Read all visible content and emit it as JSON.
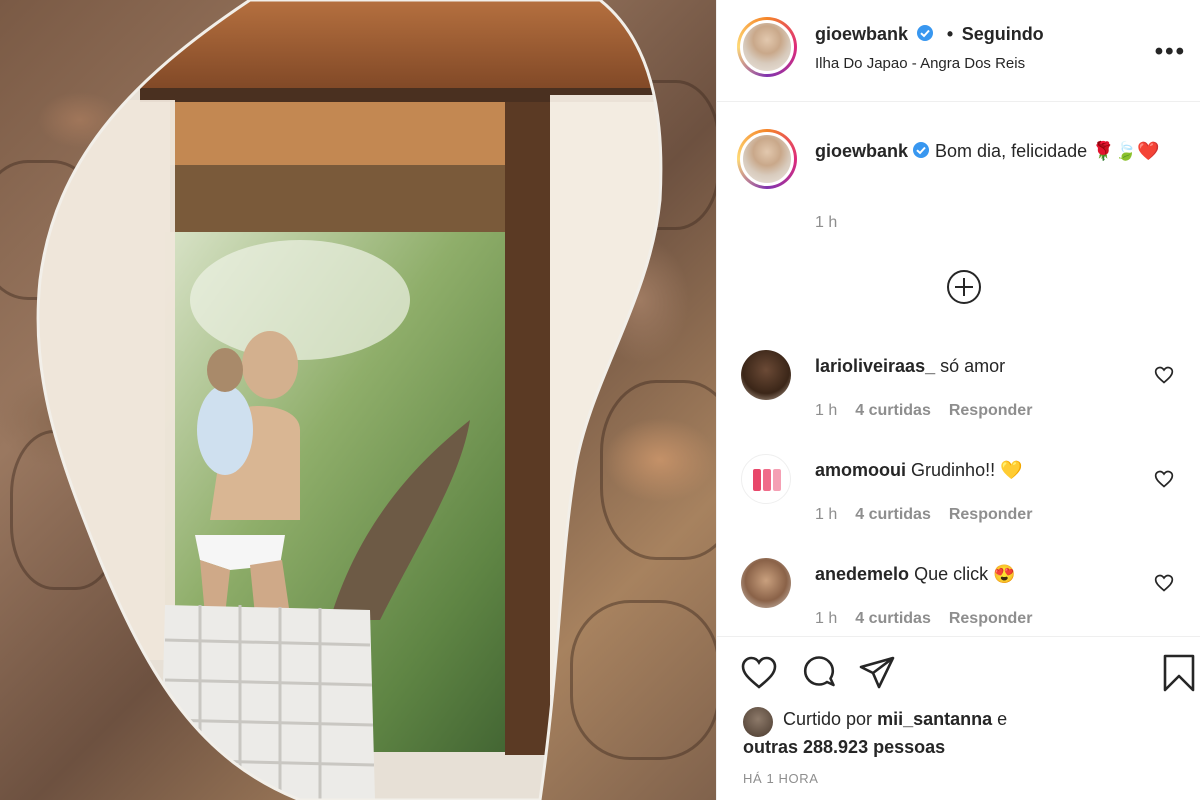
{
  "post": {
    "username": "gioewbank",
    "follow_status": "Seguindo",
    "follow_separator": "•",
    "location": "Ilha Do Japao - Angra Dos Reis",
    "more_label": "•••"
  },
  "caption": {
    "username": "gioewbank",
    "text": "Bom dia, felicidade 🌹🍃❤️",
    "time": "1 h"
  },
  "comments": [
    {
      "username": "larioliveiraas_",
      "text": "só amor",
      "time": "1 h",
      "likes": "4 curtidas",
      "reply": "Responder"
    },
    {
      "username": "amomooui",
      "text": "Grudinho!! 💛",
      "time": "1 h",
      "likes": "4 curtidas",
      "reply": "Responder"
    },
    {
      "username": "anedemelo",
      "text": "Que click 😍",
      "time": "1 h",
      "likes": "4 curtidas",
      "reply": "Responder"
    }
  ],
  "likes": {
    "prefix": "Curtido por",
    "user": "mii_santanna",
    "and": "e",
    "others": "outras 288.923 pessoas"
  },
  "timestamp": "HÁ 1 HORA",
  "icons": {
    "verified": "verified-badge-icon",
    "more": "more-options-icon",
    "load_more": "plus-circle-icon",
    "like": "heart-icon",
    "comment": "comment-bubble-icon",
    "share": "paper-plane-icon",
    "save": "bookmark-icon"
  },
  "colors": {
    "verified_blue": "#3897f0",
    "text": "#262626",
    "muted": "#8e8e8e"
  }
}
